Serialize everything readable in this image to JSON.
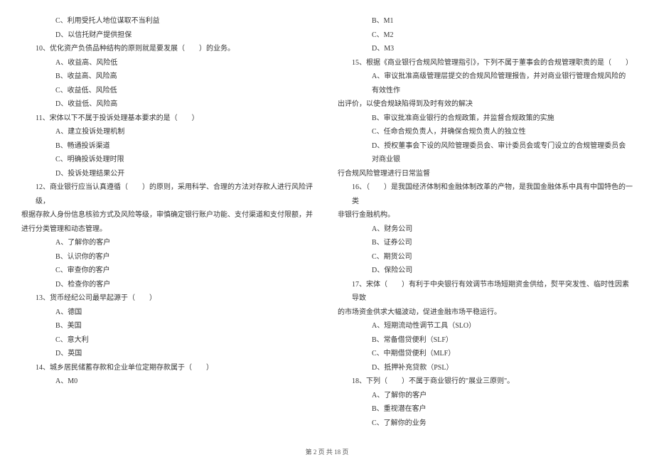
{
  "left": {
    "opts_9": [
      "C、利用受托人地位谋取不当利益",
      "D、以信托财产提供担保"
    ],
    "q10": "10、优化资产负债品种结构的原则就是要发展（　　）的业务。",
    "opts_10": [
      "A、收益高、风险低",
      "B、收益高、风险高",
      "C、收益低、风险低",
      "D、收益低、风险高"
    ],
    "q11": "11、宋体以下不属于投诉处理基本要求的是（　　）",
    "opts_11": [
      "A、建立投诉处理机制",
      "B、畅通投诉渠道",
      "C、明确投诉处理时限",
      "D、投诉处理结果公开"
    ],
    "q12_l1": "12、商业银行应当认真遵循（　　）的原则，采用科学、合理的方法对存款人进行风险评级，",
    "q12_l2": "根据存款人身份信息核验方式及风险等级，审慎确定银行账户功能、支付渠道和支付限额，并",
    "q12_l3": "进行分类管理和动态管理。",
    "opts_12": [
      "A、了解你的客户",
      "B、认识你的客户",
      "C、审查你的客户",
      "D、检查你的客户"
    ],
    "q13": "13、货币经纪公司最早起源于（　　）",
    "opts_13": [
      "A、德国",
      "B、美国",
      "C、意大利",
      "D、英国"
    ],
    "q14": "14、城乡居民储蓄存款和企业单位定期存款属于（　　）",
    "opts_14_a": "A、M0"
  },
  "right": {
    "opts_14": [
      "B、M1",
      "C、M2",
      "D、M3"
    ],
    "q15_l1": "15、根据《商业银行合规风险管理指引》，下列不属于董事会的合规管理职责的是（　　）",
    "q15_a1": "A、审议批准高级管理层提交的合规风险管理报告，并对商业银行管理合规风险的有效性作",
    "q15_a2": "出评价，以使合规缺陷得到及时有效的解决",
    "opts_15_b": "B、审议批准商业银行的合规政策，并监督合规政策的实施",
    "opts_15_c": "C、任命合规负责人，并确保合规负责人的独立性",
    "q15_d1": "D、授权董事会下设的风险管理委员会、审计委员会或专门设立的合规管理委员会对商业银",
    "q15_d2": "行合规风险管理进行日常监督",
    "q16_l1": "16、（　　）是我国经济体制和金融体制改革的产物，是我国金融体系中具有中国特色的一类",
    "q16_l2": "非银行金融机构。",
    "opts_16": [
      "A、财务公司",
      "B、证券公司",
      "C、期货公司",
      "D、保险公司"
    ],
    "q17_l1": "17、宋体（　　）有利于中央银行有效调节市场短期资金供给，熨平突发性、临时性因素导致",
    "q17_l2": "的市场资金供求大幅波动，促进金融市场平稳运行。",
    "opts_17": [
      "A、短期流动性调节工具（SLO）",
      "B、常备借贷便利（SLF）",
      "C、中期借贷便利（MLF）",
      "D、抵押补充贷款（PSL）"
    ],
    "q18": "18、下列（　　）不属于商业银行的\"展业三原则\"。",
    "opts_18": [
      "A、了解你的客户",
      "B、重视潜在客户",
      "C、了解你的业务"
    ]
  },
  "footer": "第 2 页 共 18 页"
}
